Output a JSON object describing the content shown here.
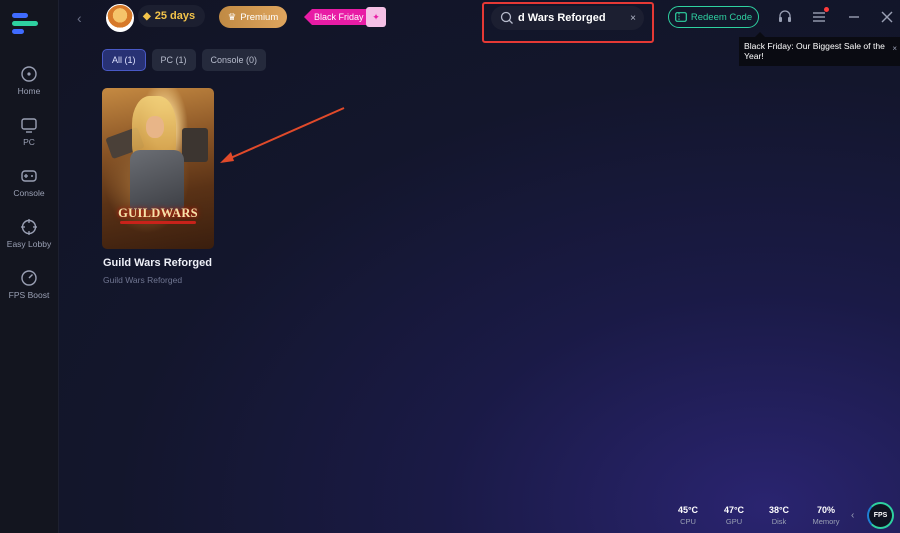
{
  "header": {
    "days": "25 days",
    "premium_label": "Premium",
    "black_friday_label": "Black Friday",
    "search": {
      "value": "d Wars Reforged",
      "placeholder": "",
      "clear_icon": "×"
    },
    "redeem_label": "Redeem Code",
    "tooltip": "Black Friday: Our Biggest Sale of the Year!",
    "tooltip_close": "×"
  },
  "sidebar": {
    "items": [
      {
        "label": "Home",
        "icon": "home-icon"
      },
      {
        "label": "PC",
        "icon": "monitor-icon"
      },
      {
        "label": "Console",
        "icon": "gamepad-icon"
      },
      {
        "label": "Easy Lobby",
        "icon": "crosshair-icon"
      },
      {
        "label": "FPS Boost",
        "icon": "gauge-icon"
      }
    ]
  },
  "filters": [
    {
      "label": "All (1)",
      "active": true
    },
    {
      "label": "PC (1)",
      "active": false
    },
    {
      "label": "Console (0)",
      "active": false
    }
  ],
  "results": [
    {
      "title": "Guild Wars Reforged",
      "subtitle": "Guild Wars Reforged",
      "cover_text": "GUILDWARS"
    }
  ],
  "status": {
    "cpu": {
      "value": "45°C",
      "label": "CPU"
    },
    "gpu": {
      "value": "47°C",
      "label": "GPU"
    },
    "disk": {
      "value": "38°C",
      "label": "Disk"
    },
    "memory": {
      "value": "70%",
      "label": "Memory"
    },
    "fps_badge": "FPS"
  },
  "colors": {
    "accent_green": "#2ed1a0",
    "highlight_red": "#e53935",
    "premium_gold": "#c08a44",
    "black_friday_pink": "#e81ca5"
  }
}
